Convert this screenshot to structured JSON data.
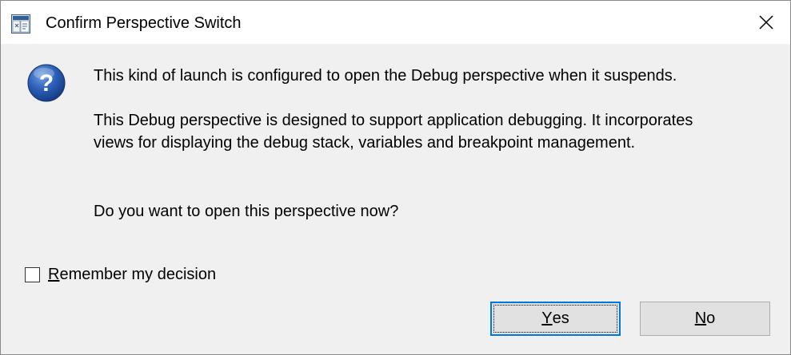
{
  "window": {
    "title": "Confirm Perspective Switch",
    "app_icon": "eclipse-window-icon",
    "close_icon": "close-icon"
  },
  "message": {
    "icon": "question-icon",
    "line1": "This kind of launch is configured to open the Debug perspective when it suspends.",
    "line2": "This Debug perspective is designed to support application debugging.  It incorporates views for displaying the debug stack, variables and breakpoint management.",
    "line3": "Do you want to open this perspective now?"
  },
  "remember": {
    "mnemonic": "R",
    "label_rest": "emember my decision",
    "checked": false
  },
  "buttons": {
    "yes": {
      "mnemonic": "Y",
      "rest": "es"
    },
    "no": {
      "mnemonic": "N",
      "rest": "o"
    }
  },
  "colors": {
    "dialog_bg": "#f0f0f0",
    "titlebar_bg": "#ffffff",
    "button_bg": "#e1e1e1",
    "focus_border": "#0078d7",
    "question_icon_blue": "#1f4fa3"
  }
}
